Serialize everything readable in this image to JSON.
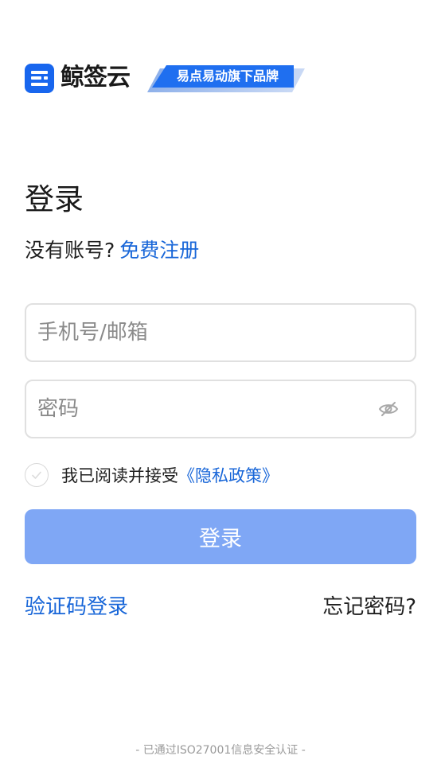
{
  "brand": {
    "name": "鲸签云",
    "tagline": "易点易动旗下品牌",
    "accent_color": "#1866ee",
    "icon": "app-logo-icon"
  },
  "login": {
    "title": "登录",
    "no_account_prompt": "没有账号?",
    "register_link": "免费注册",
    "phone_placeholder": "手机号/邮箱",
    "password_placeholder": "密码",
    "password_toggle_icon": "eye-hidden-icon",
    "agree_text": "我已阅读并接受",
    "privacy_link": "《隐私政策》",
    "agree_checked": false,
    "submit_label": "登录",
    "submit_color": "#7fa7f5",
    "sms_login_link": "验证码登录",
    "forgot_password_link": "忘记密码?"
  },
  "footer": {
    "certification": "- 已通过ISO27001信息安全认证 -"
  }
}
